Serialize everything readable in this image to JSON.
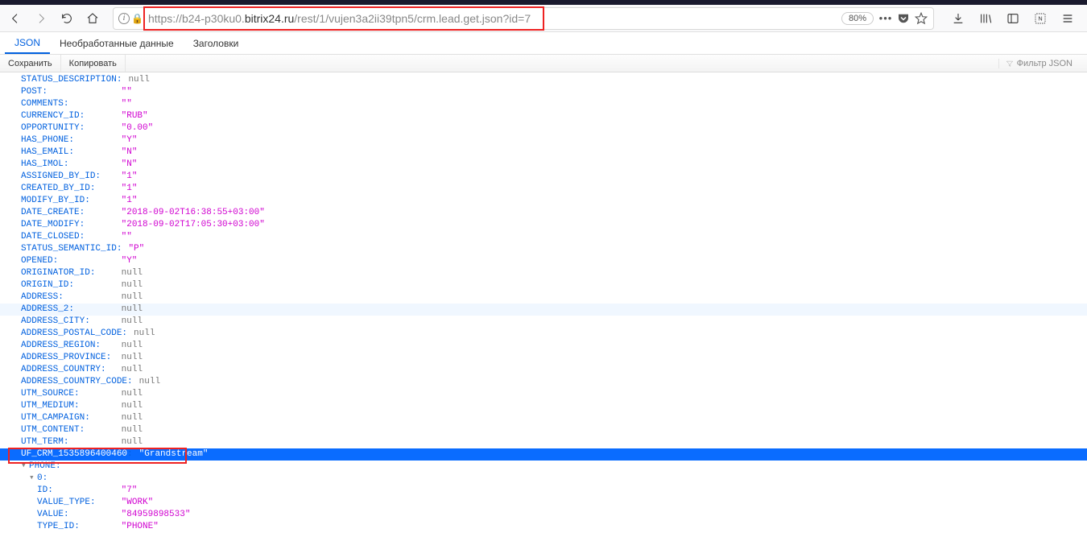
{
  "browser": {
    "url_prefix": "https://b24-p30ku0.",
    "url_bold": "bitrix24.ru",
    "url_suffix": "/rest/1/vujen3a2ii39tpn5/crm.lead.get.json?id=7",
    "zoom": "80%"
  },
  "tabs": {
    "json": "JSON",
    "raw": "Необработанные данные",
    "headers": "Заголовки"
  },
  "actions": {
    "save": "Сохранить",
    "copy": "Копировать",
    "filter_placeholder": "Фильтр JSON"
  },
  "json_entries": [
    {
      "indent": 2,
      "key": "STATUS_DESCRIPTION",
      "t": "null",
      "v": "null"
    },
    {
      "indent": 2,
      "key": "POST",
      "t": "str",
      "v": "\"\""
    },
    {
      "indent": 2,
      "key": "COMMENTS",
      "t": "str",
      "v": "\"\""
    },
    {
      "indent": 2,
      "key": "CURRENCY_ID",
      "t": "str",
      "v": "\"RUB\""
    },
    {
      "indent": 2,
      "key": "OPPORTUNITY",
      "t": "str",
      "v": "\"0.00\""
    },
    {
      "indent": 2,
      "key": "HAS_PHONE",
      "t": "str",
      "v": "\"Y\""
    },
    {
      "indent": 2,
      "key": "HAS_EMAIL",
      "t": "str",
      "v": "\"N\""
    },
    {
      "indent": 2,
      "key": "HAS_IMOL",
      "t": "str",
      "v": "\"N\""
    },
    {
      "indent": 2,
      "key": "ASSIGNED_BY_ID",
      "t": "str",
      "v": "\"1\""
    },
    {
      "indent": 2,
      "key": "CREATED_BY_ID",
      "t": "str",
      "v": "\"1\""
    },
    {
      "indent": 2,
      "key": "MODIFY_BY_ID",
      "t": "str",
      "v": "\"1\""
    },
    {
      "indent": 2,
      "key": "DATE_CREATE",
      "t": "str",
      "v": "\"2018-09-02T16:38:55+03:00\""
    },
    {
      "indent": 2,
      "key": "DATE_MODIFY",
      "t": "str",
      "v": "\"2018-09-02T17:05:30+03:00\""
    },
    {
      "indent": 2,
      "key": "DATE_CLOSED",
      "t": "str",
      "v": "\"\""
    },
    {
      "indent": 2,
      "key": "STATUS_SEMANTIC_ID",
      "t": "str",
      "v": "\"P\""
    },
    {
      "indent": 2,
      "key": "OPENED",
      "t": "str",
      "v": "\"Y\""
    },
    {
      "indent": 2,
      "key": "ORIGINATOR_ID",
      "t": "null",
      "v": "null"
    },
    {
      "indent": 2,
      "key": "ORIGIN_ID",
      "t": "null",
      "v": "null"
    },
    {
      "indent": 2,
      "key": "ADDRESS",
      "t": "null",
      "v": "null"
    },
    {
      "indent": 2,
      "key": "ADDRESS_2",
      "t": "null",
      "v": "null",
      "hover": true
    },
    {
      "indent": 2,
      "key": "ADDRESS_CITY",
      "t": "null",
      "v": "null"
    },
    {
      "indent": 2,
      "key": "ADDRESS_POSTAL_CODE",
      "t": "null",
      "v": "null"
    },
    {
      "indent": 2,
      "key": "ADDRESS_REGION",
      "t": "null",
      "v": "null"
    },
    {
      "indent": 2,
      "key": "ADDRESS_PROVINCE",
      "t": "null",
      "v": "null"
    },
    {
      "indent": 2,
      "key": "ADDRESS_COUNTRY",
      "t": "null",
      "v": "null"
    },
    {
      "indent": 2,
      "key": "ADDRESS_COUNTRY_CODE",
      "t": "null",
      "v": "null"
    },
    {
      "indent": 2,
      "key": "UTM_SOURCE",
      "t": "null",
      "v": "null"
    },
    {
      "indent": 2,
      "key": "UTM_MEDIUM",
      "t": "null",
      "v": "null"
    },
    {
      "indent": 2,
      "key": "UTM_CAMPAIGN",
      "t": "null",
      "v": "null"
    },
    {
      "indent": 2,
      "key": "UTM_CONTENT",
      "t": "null",
      "v": "null"
    },
    {
      "indent": 2,
      "key": "UTM_TERM",
      "t": "null",
      "v": "null"
    },
    {
      "indent": 2,
      "key": "UF_CRM_1535896400460",
      "t": "str",
      "v": "\"Grandstream\"",
      "selected": true,
      "boxed": true
    },
    {
      "indent": 2,
      "key": "PHONE",
      "t": "obj",
      "v": "",
      "arrow": true
    },
    {
      "indent": 3,
      "key": "0",
      "t": "obj",
      "v": "",
      "arrow": true
    },
    {
      "indent": 4,
      "key": "ID",
      "t": "str",
      "v": "\"7\""
    },
    {
      "indent": 4,
      "key": "VALUE_TYPE",
      "t": "str",
      "v": "\"WORK\""
    },
    {
      "indent": 4,
      "key": "VALUE",
      "t": "str",
      "v": "\"84959898533\""
    },
    {
      "indent": 4,
      "key": "TYPE_ID",
      "t": "str",
      "v": "\"PHONE\""
    }
  ]
}
